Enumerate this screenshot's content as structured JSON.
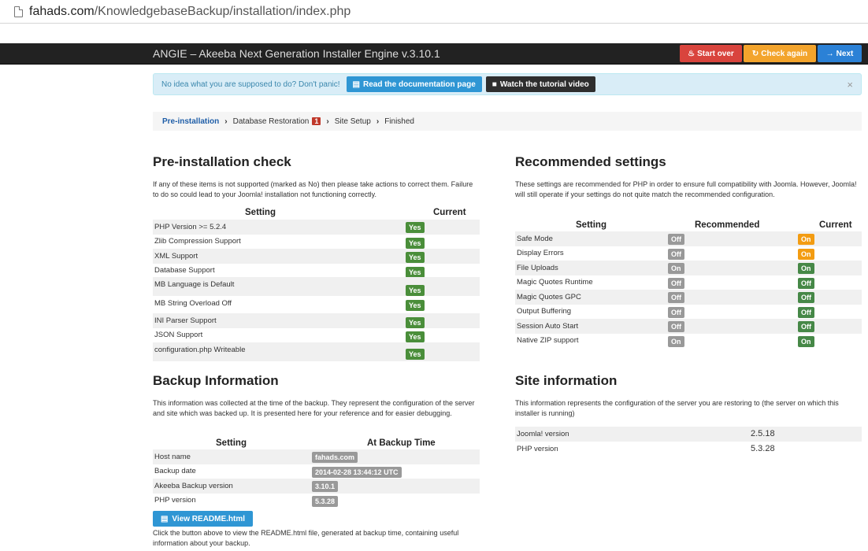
{
  "browser": {
    "host": "fahads.com",
    "path": "/KnowledgebaseBackup/installation/index.php"
  },
  "header": {
    "title": "ANGIE – Akeeba Next Generation Installer Engine v.3.10.1",
    "start_over": "Start over",
    "check_again": "Check again",
    "next": "Next"
  },
  "alert": {
    "text": "No idea what you are supposed to do? Don't panic!",
    "doc_button": "Read the documentation page",
    "video_button": "Watch the tutorial video",
    "close": "×"
  },
  "breadcrumb": {
    "pre": "Pre-installation",
    "db": "Database Restoration",
    "db_badge": "1",
    "site": "Site Setup",
    "finished": "Finished"
  },
  "precheck": {
    "title": "Pre-installation check",
    "desc": "If any of these items is not supported (marked as No) then please take actions to correct them. Failure to do so could lead to your Joomla! installation not functioning correctly.",
    "col_setting": "Setting",
    "col_current": "Current",
    "rows": [
      {
        "label": "PHP Version >= 5.2.4",
        "value": "Yes"
      },
      {
        "label": "Zlib Compression Support",
        "value": "Yes"
      },
      {
        "label": "XML Support",
        "value": "Yes"
      },
      {
        "label": "Database Support",
        "value": "Yes"
      },
      {
        "label": "MB Language is Default",
        "value": "Yes"
      },
      {
        "label": "MB String Overload Off",
        "value": "Yes"
      },
      {
        "label": "INI Parser Support",
        "value": "Yes"
      },
      {
        "label": "JSON Support",
        "value": "Yes"
      },
      {
        "label": "configuration.php Writeable",
        "value": "Yes"
      }
    ]
  },
  "recommended": {
    "title": "Recommended settings",
    "desc": "These settings are recommended for PHP in order to ensure full compatibility with Joomla. However, Joomla! will still operate if your settings do not quite match the recommended configuration.",
    "col_setting": "Setting",
    "col_recommended": "Recommended",
    "col_current": "Current",
    "rows": [
      {
        "label": "Safe Mode",
        "recommended": "Off",
        "current": "On"
      },
      {
        "label": "Display Errors",
        "recommended": "Off",
        "current": "On"
      },
      {
        "label": "File Uploads",
        "recommended": "On",
        "current": "On"
      },
      {
        "label": "Magic Quotes Runtime",
        "recommended": "Off",
        "current": "Off"
      },
      {
        "label": "Magic Quotes GPC",
        "recommended": "Off",
        "current": "Off"
      },
      {
        "label": "Output Buffering",
        "recommended": "Off",
        "current": "Off"
      },
      {
        "label": "Session Auto Start",
        "recommended": "Off",
        "current": "Off"
      },
      {
        "label": "Native ZIP support",
        "recommended": "On",
        "current": "On"
      }
    ],
    "colors": {
      "warn": "#f39c12",
      "ok": "#468847"
    }
  },
  "backup": {
    "title": "Backup Information",
    "desc": "This information was collected at the time of the backup. They represent the configuration of the server and site which was backed up. It is presented here for your reference and for easier debugging.",
    "col_setting": "Setting",
    "col_time": "At Backup Time",
    "rows": [
      {
        "label": "Host name",
        "value": "fahads.com"
      },
      {
        "label": "Backup date",
        "value": "2014-02-28 13:44:12 UTC"
      },
      {
        "label": "Akeeba Backup version",
        "value": "3.10.1"
      },
      {
        "label": "PHP version",
        "value": "5.3.28"
      }
    ],
    "readme_button": "View README.html",
    "readme_desc": "Click the button above to view the README.html file, generated at backup time, containing useful information about your backup."
  },
  "siteinfo": {
    "title": "Site information",
    "desc": "This information represents the configuration of the server you are restoring to (the server on which this installer is running)",
    "rows": [
      {
        "label": "Joomla! version",
        "value": "2.5.18"
      },
      {
        "label": "PHP version",
        "value": "5.3.28"
      }
    ]
  }
}
